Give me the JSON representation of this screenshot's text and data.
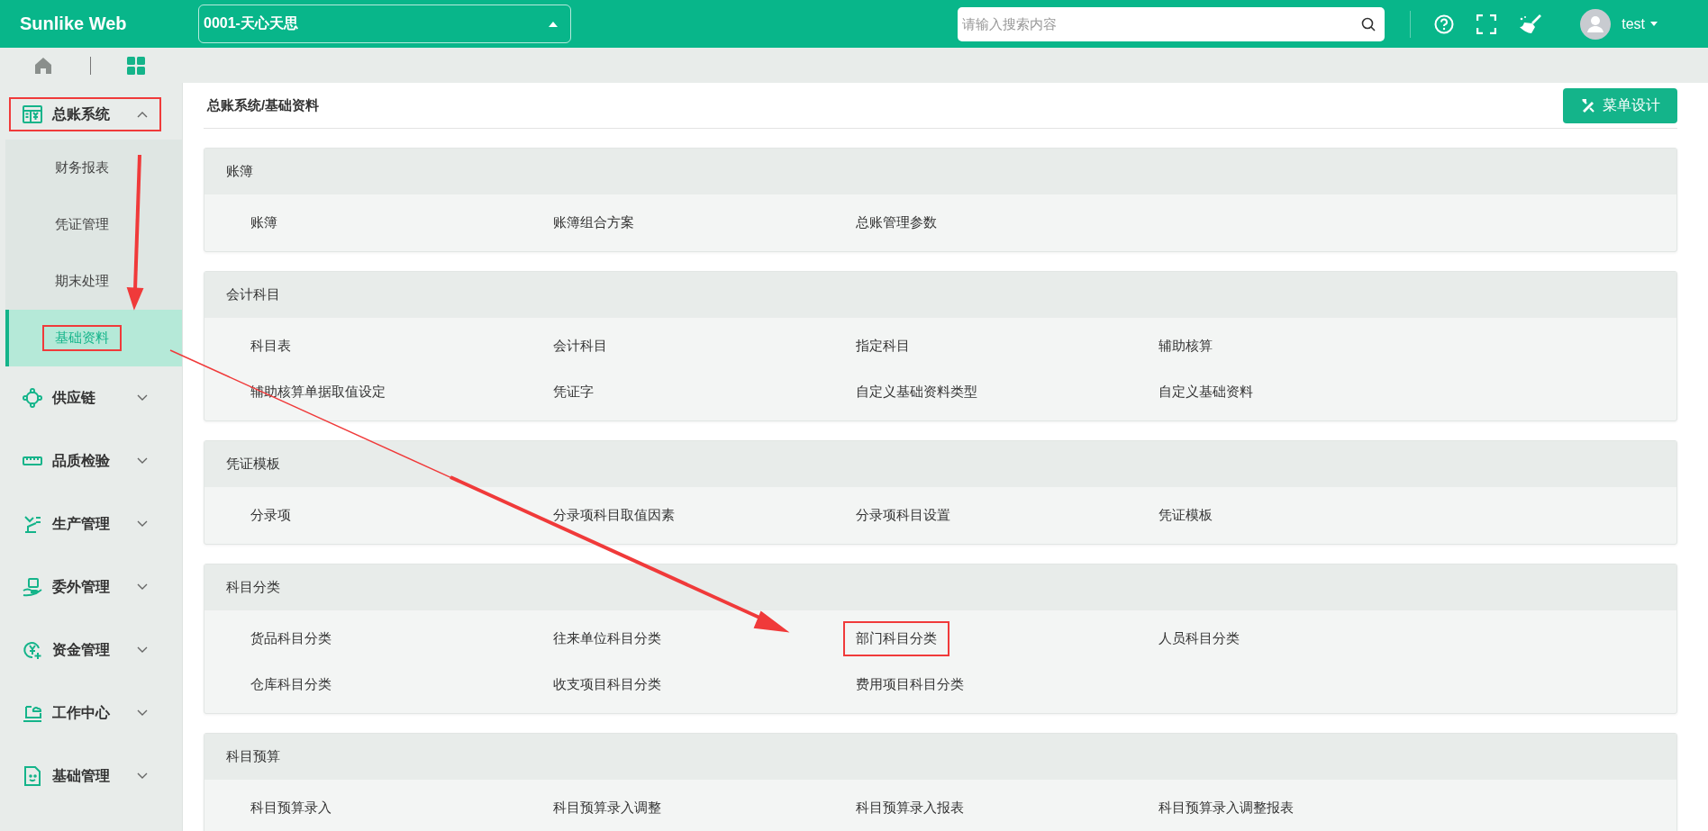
{
  "app": {
    "logo": "Sunlike Web"
  },
  "company": {
    "value": "0001-天心天思"
  },
  "search": {
    "placeholder": "请输入搜索内容"
  },
  "user": {
    "name": "test"
  },
  "breadcrumb": "总账系统/基础资料",
  "design_button": "菜单设计",
  "sidebar": {
    "groups": [
      {
        "label": "总账系统",
        "expanded": true,
        "marked": true,
        "children": [
          {
            "label": "财务报表",
            "selected": false,
            "marked": false
          },
          {
            "label": "凭证管理",
            "selected": false,
            "marked": false
          },
          {
            "label": "期末处理",
            "selected": false,
            "marked": false
          },
          {
            "label": "基础资料",
            "selected": true,
            "marked": true
          }
        ]
      },
      {
        "label": "供应链",
        "expanded": false,
        "marked": false
      },
      {
        "label": "品质检验",
        "expanded": false,
        "marked": false
      },
      {
        "label": "生产管理",
        "expanded": false,
        "marked": false
      },
      {
        "label": "委外管理",
        "expanded": false,
        "marked": false
      },
      {
        "label": "资金管理",
        "expanded": false,
        "marked": false
      },
      {
        "label": "工作中心",
        "expanded": false,
        "marked": false
      },
      {
        "label": "基础管理",
        "expanded": false,
        "marked": false
      }
    ]
  },
  "sections": [
    {
      "title": "账簿",
      "links": [
        {
          "label": "账簿",
          "marked": false
        },
        {
          "label": "账簿组合方案",
          "marked": false
        },
        {
          "label": "总账管理参数",
          "marked": false
        }
      ]
    },
    {
      "title": "会计科目",
      "links": [
        {
          "label": "科目表",
          "marked": false
        },
        {
          "label": "会计科目",
          "marked": false
        },
        {
          "label": "指定科目",
          "marked": false
        },
        {
          "label": "辅助核算",
          "marked": false
        },
        {
          "label": "辅助核算单据取值设定",
          "marked": false
        },
        {
          "label": "凭证字",
          "marked": false
        },
        {
          "label": "自定义基础资料类型",
          "marked": false
        },
        {
          "label": "自定义基础资料",
          "marked": false
        }
      ]
    },
    {
      "title": "凭证模板",
      "links": [
        {
          "label": "分录项",
          "marked": false
        },
        {
          "label": "分录项科目取值因素",
          "marked": false
        },
        {
          "label": "分录项科目设置",
          "marked": false
        },
        {
          "label": "凭证模板",
          "marked": false
        }
      ]
    },
    {
      "title": "科目分类",
      "links": [
        {
          "label": "货品科目分类",
          "marked": false
        },
        {
          "label": "往来单位科目分类",
          "marked": false
        },
        {
          "label": "部门科目分类",
          "marked": true
        },
        {
          "label": "人员科目分类",
          "marked": false
        },
        {
          "label": "仓库科目分类",
          "marked": false
        },
        {
          "label": "收支项目科目分类",
          "marked": false
        },
        {
          "label": "费用项目科目分类",
          "marked": false
        }
      ]
    },
    {
      "title": "科目预算",
      "links": [
        {
          "label": "科目预算录入",
          "marked": false
        },
        {
          "label": "科目预算录入调整",
          "marked": false
        },
        {
          "label": "科目预算录入报表",
          "marked": false
        },
        {
          "label": "科目预算录入调整报表",
          "marked": false
        }
      ]
    }
  ]
}
